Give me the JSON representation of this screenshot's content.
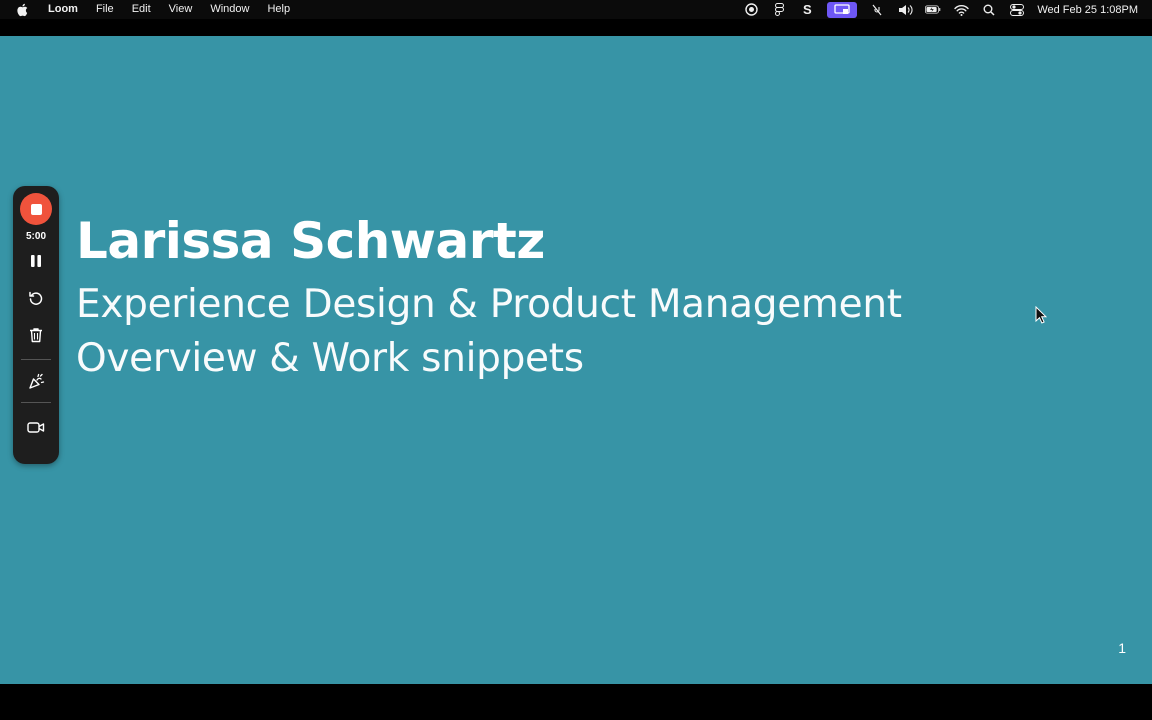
{
  "menubar": {
    "app_name": "Loom",
    "menus": [
      "File",
      "Edit",
      "View",
      "Window",
      "Help"
    ],
    "tray_icons": [
      "screen-record-icon",
      "figma-icon",
      "s-app-icon",
      "screen-share-icon",
      "mic-off-icon",
      "volume-icon",
      "battery-icon",
      "wifi-icon",
      "search-icon",
      "control-center-icon"
    ],
    "clock": "Wed Feb 25  1:08PM",
    "accent_color": "#6e57f5"
  },
  "slide": {
    "title": "Larissa Schwartz",
    "subtitle_line1": "Experience Design & Product Management",
    "subtitle_line2": "Overview & Work snippets",
    "page_number": "1",
    "background_color": "#3794a6"
  },
  "loom_toolbar": {
    "timer": "5:00",
    "stop_color": "#f0533c",
    "tools": [
      "pause-icon",
      "restart-icon",
      "trash-icon",
      "confetti-icon",
      "camera-icon"
    ]
  }
}
